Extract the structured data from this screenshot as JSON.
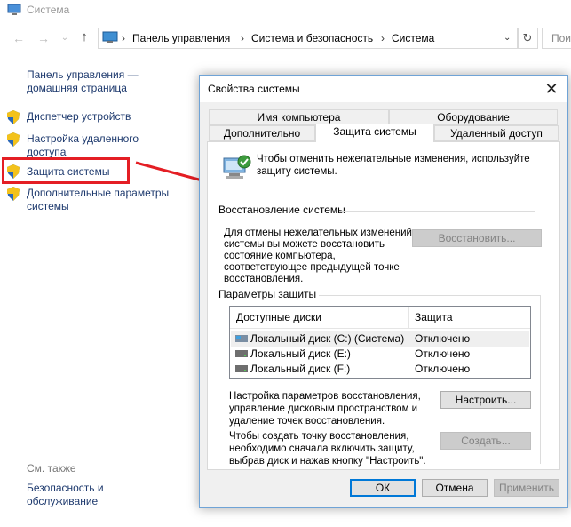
{
  "window": {
    "title": "Система"
  },
  "address": {
    "crumbs": [
      "Панель управления",
      "Система и безопасность",
      "Система"
    ],
    "search_text": "Пои"
  },
  "leftnav": {
    "home_line1": "Панель управления —",
    "home_line2": "домашняя страница",
    "devices": "Диспетчер устройств",
    "remote_line1": "Настройка удаленного",
    "remote_line2": "доступа",
    "protection": "Защита системы",
    "advanced_line1": "Дополнительные параметры",
    "advanced_line2": "системы",
    "see_also": "См. также",
    "security_line1": "Безопасность и",
    "security_line2": "обслуживание"
  },
  "edge_fragments": [
    "4",
    "е",
    "е"
  ],
  "dialog": {
    "title": "Свойства системы",
    "tabs_row1": [
      "Имя компьютера",
      "Оборудование"
    ],
    "tabs_row2": [
      "Дополнительно",
      "Защита системы",
      "Удаленный доступ"
    ],
    "intro_line1": "Чтобы отменить нежелательные изменения, используйте",
    "intro_line2": "защиту системы.",
    "restore_group": "Восстановление системы",
    "restore_text": [
      "Для отмены нежелательных изменений",
      "системы вы можете восстановить",
      "состояние компьютера,",
      "соответствующее предыдущей точке",
      "восстановления."
    ],
    "restore_button": "Восстановить...",
    "protection_group": "Параметры защиты",
    "table": {
      "columns": [
        "Доступные диски",
        "Защита"
      ],
      "rows": [
        {
          "disk": "Локальный диск (C:) (Система)",
          "status": "Отключено"
        },
        {
          "disk": "Локальный диск (E:)",
          "status": "Отключено"
        },
        {
          "disk": "Локальный диск (F:)",
          "status": "Отключено"
        }
      ]
    },
    "configure_text": [
      "Настройка параметров восстановления,",
      "управление дисковым пространством и",
      "удаление точек восстановления."
    ],
    "configure_button": "Настроить...",
    "create_text": [
      "Чтобы создать точку восстановления,",
      "необходимо сначала включить защиту,",
      "выбрав диск и нажав кнопку \"Настроить\"."
    ],
    "create_button": "Создать...",
    "ok": "ОК",
    "cancel": "Отмена",
    "apply": "Применить"
  },
  "colors": {
    "highlight": "#e41e24",
    "link": "#1e3a6e",
    "accent": "#0078d7"
  }
}
